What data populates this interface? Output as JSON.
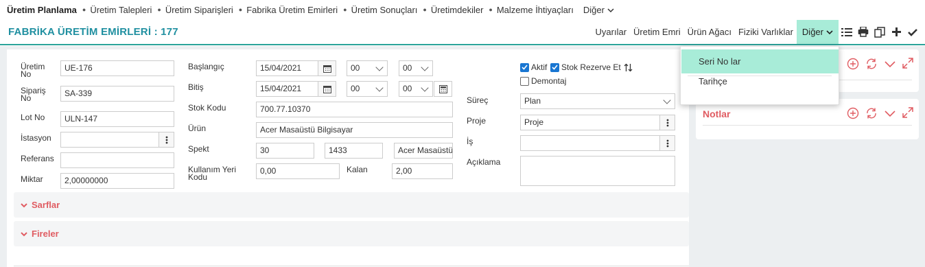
{
  "topnav": {
    "items": [
      "Üretim Planlama",
      "Üretim Talepleri",
      "Üretim Siparişleri",
      "Fabrika Üretim Emirleri",
      "Üretim Sonuçları",
      "Üretimdekiler",
      "Malzeme İhtiyaçları",
      "Diğer"
    ]
  },
  "header": {
    "title": "FABRİKA ÜRETİM EMİRLERİ : 177",
    "toolbar": {
      "uyarilar": "Uyarılar",
      "uretim_emri": "Üretim Emri",
      "urun_agaci": "Ürün Ağacı",
      "fiziki": "Fiziki Varlıklar",
      "diger": "Diğer"
    },
    "icons": [
      "list-icon",
      "print-icon",
      "copy-icon",
      "plus-icon",
      "check-icon"
    ]
  },
  "form": {
    "uretim_no_label": "Üretim No",
    "uretim_no": "UE-176",
    "siparis_no_label": "Sipariş No",
    "siparis_no": "SA-339",
    "lot_no_label": "Lot No",
    "lot_no": "ULN-147",
    "istasyon_label": "İstasyon",
    "istasyon": "",
    "referans_label": "Referans",
    "referans": "",
    "miktar_label": "Miktar",
    "miktar": "2,00000000",
    "baslangic_label": "Başlangıç",
    "baslangic_date": "15/04/2021",
    "baslangic_h": "00",
    "baslangic_m": "00",
    "bitis_label": "Bitiş",
    "bitis_date": "15/04/2021",
    "bitis_h": "00",
    "bitis_m": "00",
    "stok_kodu_label": "Stok Kodu",
    "stok_kodu": "700.77.10370",
    "urun_label": "Ürün",
    "urun": "Acer Masaüstü Bilgisayar",
    "spekt_label": "Spekt",
    "spekt1": "30",
    "spekt2": "1433",
    "spekt3": "Acer Masaüstü",
    "kullanim_label": "Kullanım Yeri Kodu",
    "kullanim": "0,00",
    "kalan_label": "Kalan",
    "kalan": "2,00",
    "aktif_label": "Aktif",
    "aktif": true,
    "stok_rezerve_label": "Stok Rezerve Et",
    "stok_rezerve": true,
    "demontaj_label": "Demontaj",
    "demontaj": false,
    "surec_label": "Süreç",
    "surec": "Plan",
    "proje_label": "Proje",
    "proje": "Proje",
    "is_label": "İş",
    "is": "",
    "aciklama_label": "Açıklama",
    "aciklama": ""
  },
  "sections": {
    "sarflar": "Sarflar",
    "fireler": "Fireler"
  },
  "right": {
    "notlar": "Notlar"
  },
  "dropdown": {
    "items": [
      "Seri No lar",
      "Tarihçe"
    ]
  },
  "colors": {
    "accent": "#2ba39a",
    "title": "#1f8fa0",
    "section": "#e05c62",
    "highlight": "#a8ecd8"
  }
}
